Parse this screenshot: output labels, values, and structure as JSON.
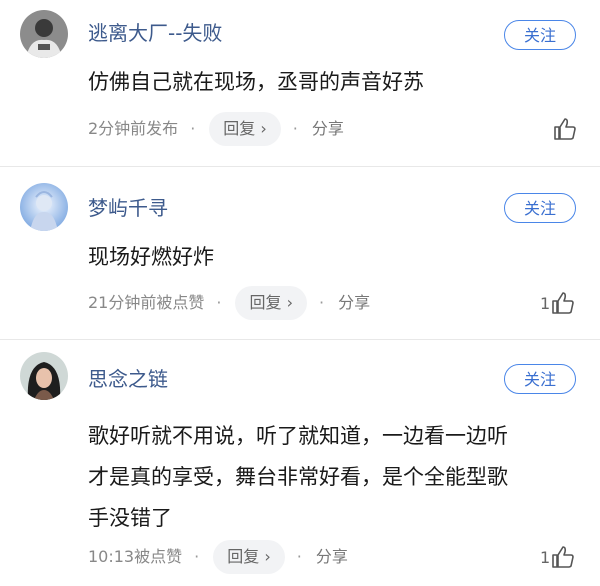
{
  "comments": [
    {
      "username": "逃离大厂--失败",
      "follow_label": "关注",
      "text": "仿佛自己就在现场，丞哥的声音好苏",
      "time": "2分钟前发布",
      "reply_label": "回复",
      "reply_chevron": "›",
      "share_label": "分享",
      "like_count": "",
      "separator": "·"
    },
    {
      "username": "梦屿千寻",
      "follow_label": "关注",
      "text": "现场好燃好炸",
      "time": "21分钟前被点赞",
      "reply_label": "回复",
      "reply_chevron": "›",
      "share_label": "分享",
      "like_count": "1",
      "separator": "·"
    },
    {
      "username": "思念之链",
      "follow_label": "关注",
      "text_lines": [
        "歌好听就不用说，听了就知道，一边看一边听",
        "才是真的享受，舞台非常好看，是个全能型歌",
        "手没错了"
      ],
      "time": "10:13被点赞",
      "reply_label": "回复",
      "reply_chevron": "›",
      "share_label": "分享",
      "like_count": "1",
      "separator": "·"
    }
  ],
  "icons": {
    "like": "thumbs-up-icon",
    "avatar": "user-avatar"
  },
  "colors": {
    "username": "#3d5a8c",
    "follow_border": "#4a86e8",
    "meta": "#888888"
  }
}
